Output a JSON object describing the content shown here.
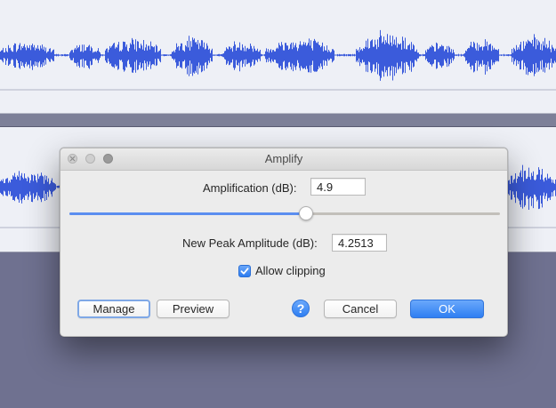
{
  "dialog": {
    "title": "Amplify",
    "amplification_label": "Amplification (dB):",
    "amplification_value": "4.9",
    "slider_level_percent": 55,
    "peak_label": "New Peak Amplitude (dB):",
    "peak_value": "4.2513",
    "allow_clipping_label": "Allow clipping",
    "allow_clipping_checked": true,
    "buttons": {
      "manage": "Manage",
      "preview": "Preview",
      "help": "?",
      "cancel": "Cancel",
      "ok": "OK"
    }
  },
  "colors": {
    "waveform": "#3b5bdb",
    "track_background": "#eef0f6",
    "workspace_background": "#6f7190",
    "accent": "#2f7ff2"
  },
  "icons": {
    "window_close": "close-icon",
    "window_minimize": "minimize-icon",
    "window_maximize": "maximize-icon",
    "checkbox": "checkmark-icon",
    "help": "help-icon"
  }
}
